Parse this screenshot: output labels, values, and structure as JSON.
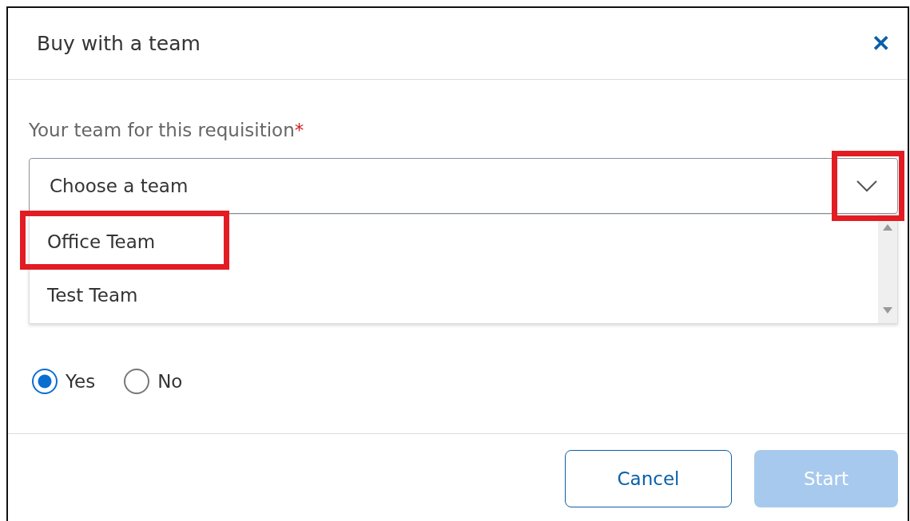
{
  "dialog": {
    "title": "Buy with a team",
    "close": "✕"
  },
  "field": {
    "label": "Your team for this requisition",
    "required_mark": "*",
    "placeholder": "Choose a team",
    "expanded": true
  },
  "options": [
    {
      "label": "Office Team",
      "highlighted": true
    },
    {
      "label": "Test Team",
      "highlighted": false
    }
  ],
  "radios": [
    {
      "label": "Yes",
      "selected": true
    },
    {
      "label": "No",
      "selected": false
    }
  ],
  "annotations": {
    "chevron_highlighted": true
  },
  "buttons": [
    {
      "label": "Cancel",
      "kind": "secondary",
      "disabled": false
    },
    {
      "label": "Start",
      "kind": "primary",
      "disabled": true
    }
  ]
}
